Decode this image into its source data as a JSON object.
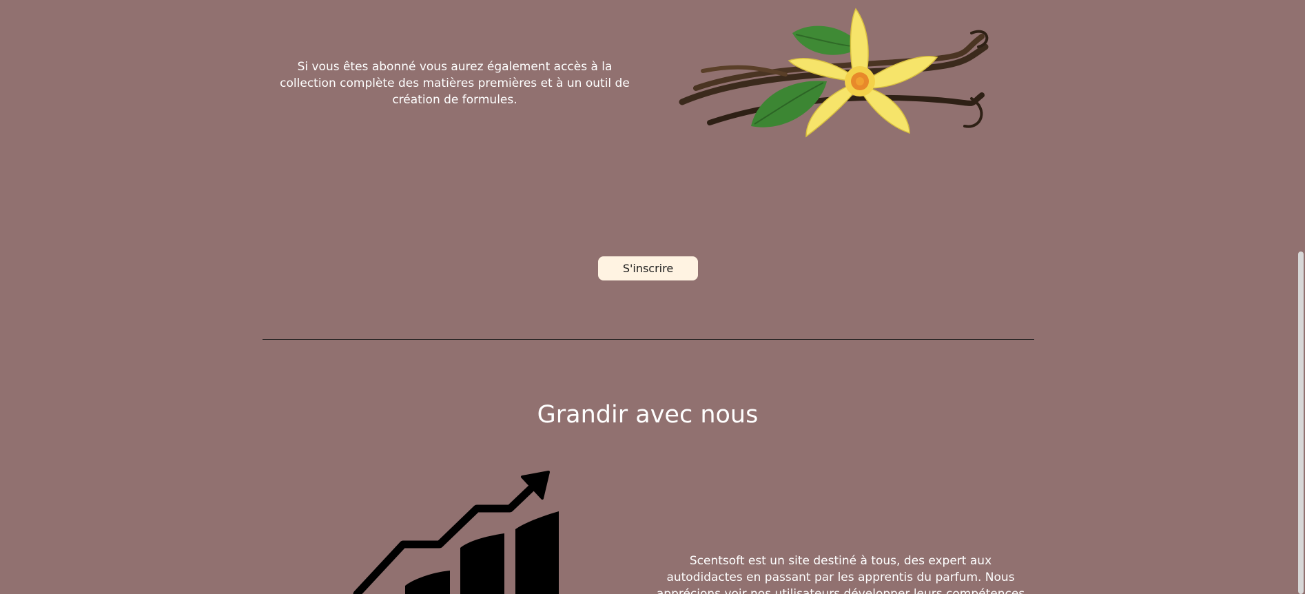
{
  "subscribe_section": {
    "text": "Si vous êtes abonné vous aurez également accès à la collection complète des matières premières et à un outil de création de formules.",
    "image": "vanilla-flower-image",
    "button_label": "S'inscrire"
  },
  "grow_section": {
    "title": "Grandir avec nous",
    "icon": "growth-chart-icon",
    "text": "Scentsoft est un site destiné à tous, des expert aux autodidactes en passant par les apprentis du parfum. Nous apprécions voir nos utilisateurs développer leurs compétences et en acquérir de"
  },
  "colors": {
    "background": "#917170",
    "button_background": "#fff3e2",
    "text": "#ffffff",
    "divider": "#1a1a1a"
  }
}
